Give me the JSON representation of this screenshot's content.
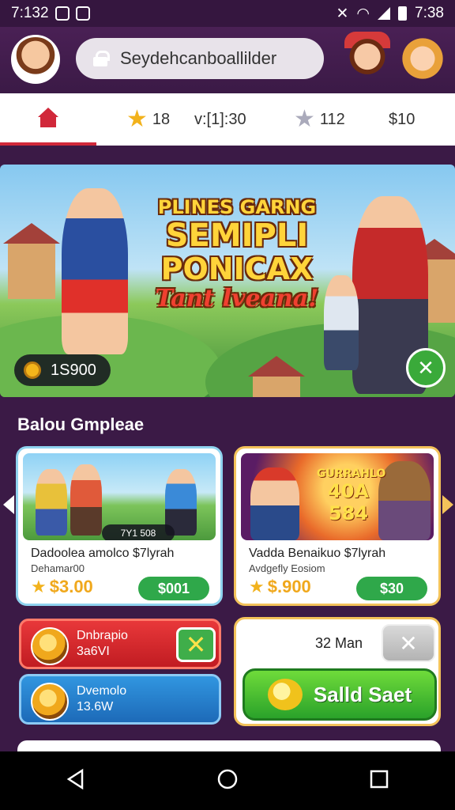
{
  "status_bar": {
    "time_left": "7:132",
    "time_right": "7:38"
  },
  "header": {
    "search_text": "Seydehcanboallilder"
  },
  "stats": {
    "stars": "18",
    "score": "v:[1]:30",
    "silver": "112",
    "coins": "$10"
  },
  "banner": {
    "title_line1": "PLINES GARNG",
    "title_line2": "SEMIPLI",
    "title_line3": "PONICAX",
    "title_line4": "Tant lveana!",
    "prize": "1S900"
  },
  "section": {
    "title": "Balou Gmpleae"
  },
  "cards": [
    {
      "tag": "7Y1 508",
      "title": "Dadoolea amolco $7lyrah",
      "subtitle": "Dehamar00",
      "price": "$3.00",
      "button": "$001"
    },
    {
      "art_top": "GURRAHLO",
      "art_mid": "40A",
      "art_bottom": "584",
      "title": "Vadda Benaikuo $7lyrah",
      "subtitle": "Avdgefly Eosiom",
      "price": "$.900",
      "button": "$30"
    }
  ],
  "promos": [
    {
      "line1": "Dnbrapio",
      "line2": "3a6VI"
    },
    {
      "line1": "Dvemolo",
      "line2": "13.6W"
    }
  ],
  "action": {
    "label": "32 Man",
    "main_button": "Salld Saet"
  }
}
